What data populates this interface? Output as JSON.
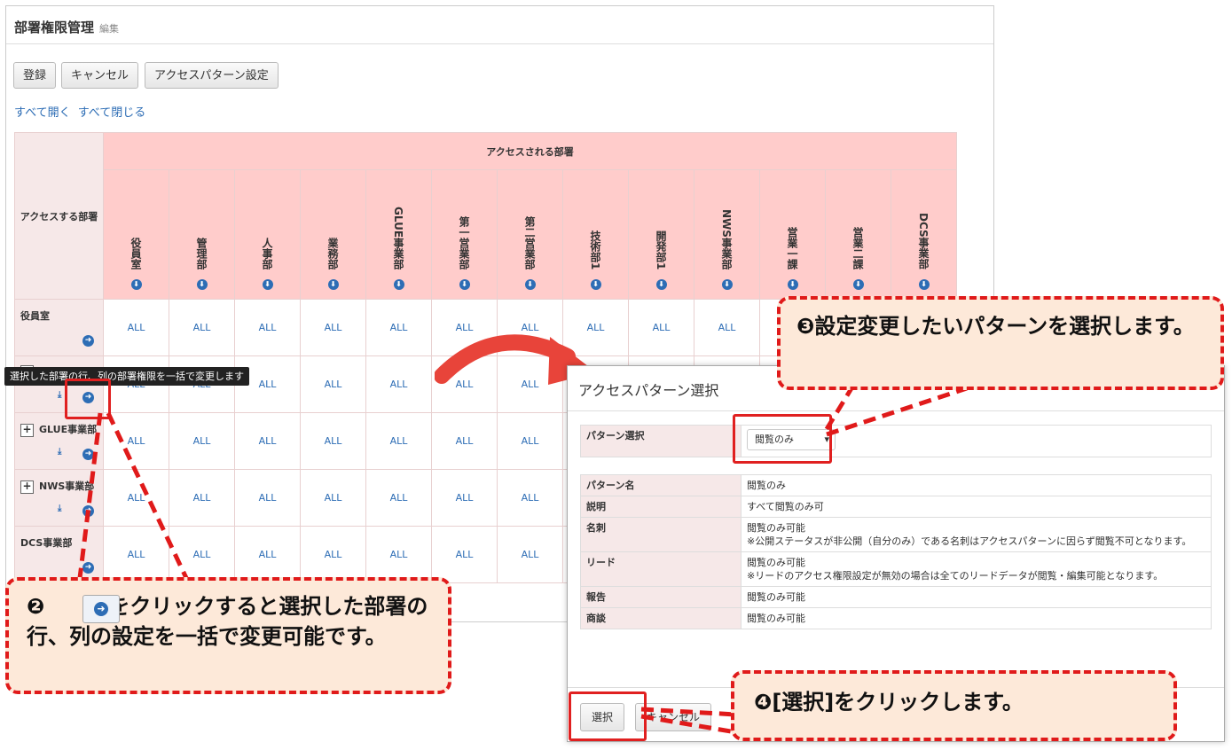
{
  "page": {
    "title": "部署権限管理",
    "subtitle": "編集"
  },
  "toolbar": {
    "register": "登録",
    "cancel": "キャンセル",
    "pattern": "アクセスパターン設定"
  },
  "links": {
    "expand": "すべて開く",
    "collapse": "すべて閉じる"
  },
  "grid": {
    "header_main": "アクセスされる部署",
    "header_corner": "アクセスする部署",
    "columns": [
      "役員室",
      "管理部",
      "人事部",
      "業務部",
      "GLUE事業部",
      "第一営業部",
      "第二営業部",
      "技術部1",
      "開発部1",
      "NWS事業部",
      "営業一課",
      "営業二課",
      "DCS事業部"
    ],
    "rows": [
      {
        "name": "役員室",
        "plus": false
      },
      {
        "name": "",
        "plus": true
      },
      {
        "name": "GLUE事業部",
        "plus": true
      },
      {
        "name": "NWS事業部",
        "plus": true
      },
      {
        "name": "DCS事業部",
        "plus": false
      }
    ],
    "value": "ALL"
  },
  "tooltip": "選択した部署の行、列の部署権限を一括で変更します",
  "dialog": {
    "title": "アクセスパターン選択",
    "select_label": "パターン選択",
    "select_value": "閲覧のみ",
    "rows": [
      {
        "k": "パターン名",
        "v": "閲覧のみ"
      },
      {
        "k": "説明",
        "v": "すべて閲覧のみ可"
      },
      {
        "k": "名刺",
        "v": "閲覧のみ可能\n※公開ステータスが非公開（自分のみ）である名刺はアクセスパターンに因らず閲覧不可となります。"
      },
      {
        "k": "リード",
        "v": "閲覧のみ可能\n※リードのアクセス権限設定が無効の場合は全てのリードデータが閲覧・編集可能となります。"
      },
      {
        "k": "報告",
        "v": "閲覧のみ可能"
      },
      {
        "k": "商談",
        "v": "閲覧のみ可能"
      }
    ],
    "select_button": "選択",
    "cancel_button": "キャンセル"
  },
  "callouts": {
    "c2": "❷　　　をクリックすると選択した部署の行、列の設定を一括で変更可能です。",
    "c3": "❸設定変更したいパターンを選択します。",
    "c4": "❹[選択]をクリックします。"
  },
  "colors": {
    "accent": "#2d6db5",
    "header_pink": "#ffcccb",
    "callout_red": "#e01a1a",
    "callout_bg": "#fde9d9"
  }
}
